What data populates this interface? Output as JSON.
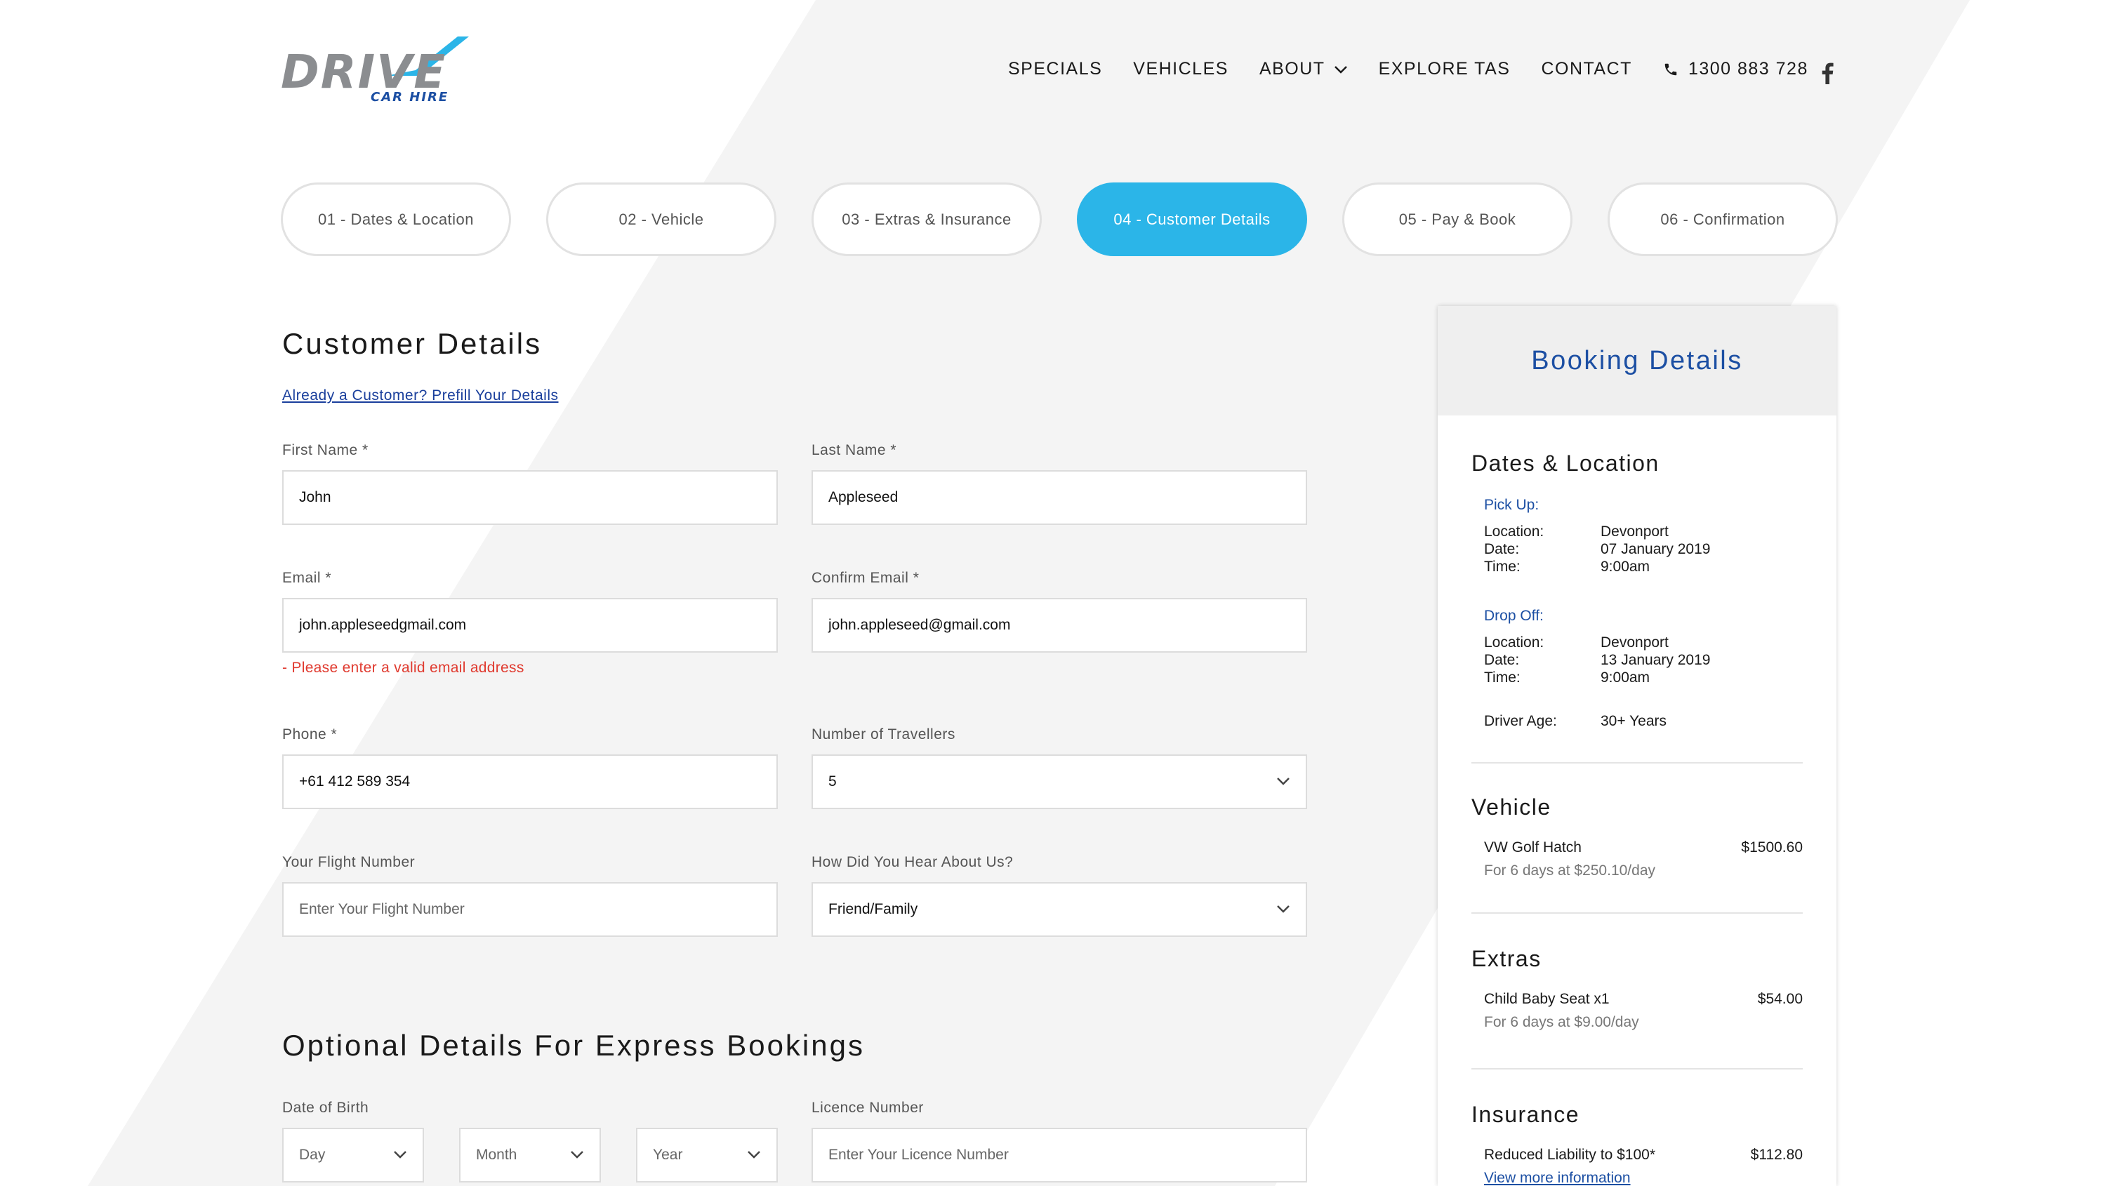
{
  "brand": {
    "logo_word": "DRIVE",
    "logo_sub": "CAR HIRE",
    "accent": "#2bb5e8",
    "brand_blue": "#1c4fa3"
  },
  "nav": {
    "specials": "SPECIALS",
    "vehicles": "VEHICLES",
    "about": "ABOUT",
    "explore": "EXPLORE TAS",
    "contact": "CONTACT",
    "phone": "1300 883 728",
    "social_icon": "facebook-icon"
  },
  "steps": [
    {
      "label": "01 - Dates & Location",
      "active": false
    },
    {
      "label": "02 - Vehicle",
      "active": false
    },
    {
      "label": "03 - Extras & Insurance",
      "active": false
    },
    {
      "label": "04 - Customer Details",
      "active": true
    },
    {
      "label": "05 - Pay & Book",
      "active": false
    },
    {
      "label": "06 - Confirmation",
      "active": false
    }
  ],
  "form": {
    "title": "Customer Details",
    "prefill_link": "Already a Customer? Prefill Your Details",
    "first_name": {
      "label": "First Name *",
      "value": "John"
    },
    "last_name": {
      "label": "Last Name *",
      "value": "Appleseed"
    },
    "email": {
      "label": "Email *",
      "value": "john.appleseedgmail.com",
      "error": "- Please enter a valid email address"
    },
    "confirm_email": {
      "label": "Confirm Email *",
      "value": "john.appleseed@gmail.com"
    },
    "phone": {
      "label": "Phone *",
      "value": "+61 412 589 354"
    },
    "travellers": {
      "label": "Number of Travellers",
      "value": "5"
    },
    "flight": {
      "label": "Your Flight Number",
      "placeholder": "Enter Your Flight Number"
    },
    "hear_about": {
      "label": "How Did You Hear About Us?",
      "value": "Friend/Family"
    }
  },
  "optional": {
    "title": "Optional Details For Express Bookings",
    "dob_label": "Date of Birth",
    "day": "Day",
    "month": "Month",
    "year": "Year",
    "licence_label": "Licence Number",
    "licence_placeholder": "Enter Your Licence Number"
  },
  "booking": {
    "title": "Booking Details",
    "dates_title": "Dates & Location",
    "pickup": {
      "heading": "Pick Up:",
      "location_label": "Location:",
      "location": "Devonport",
      "date_label": "Date:",
      "date": "07 January 2019",
      "time_label": "Time:",
      "time": "9:00am"
    },
    "dropoff": {
      "heading": "Drop Off:",
      "location_label": "Location:",
      "location": "Devonport",
      "date_label": "Date:",
      "date": "13 January 2019",
      "time_label": "Time:",
      "time": "9:00am"
    },
    "driver_age_label": "Driver Age:",
    "driver_age": "30+ Years",
    "vehicle_title": "Vehicle",
    "vehicle": {
      "name": "VW Golf Hatch",
      "price": "$1500.60",
      "sub": "For 6 days at $250.10/day"
    },
    "extras_title": "Extras",
    "extra": {
      "name": "Child Baby Seat x1",
      "price": "$54.00",
      "sub": "For 6 days at $9.00/day"
    },
    "insurance_title": "Insurance",
    "insurance": {
      "name": "Reduced Liability to $100*",
      "price": "$112.80",
      "link": "View more information"
    }
  }
}
